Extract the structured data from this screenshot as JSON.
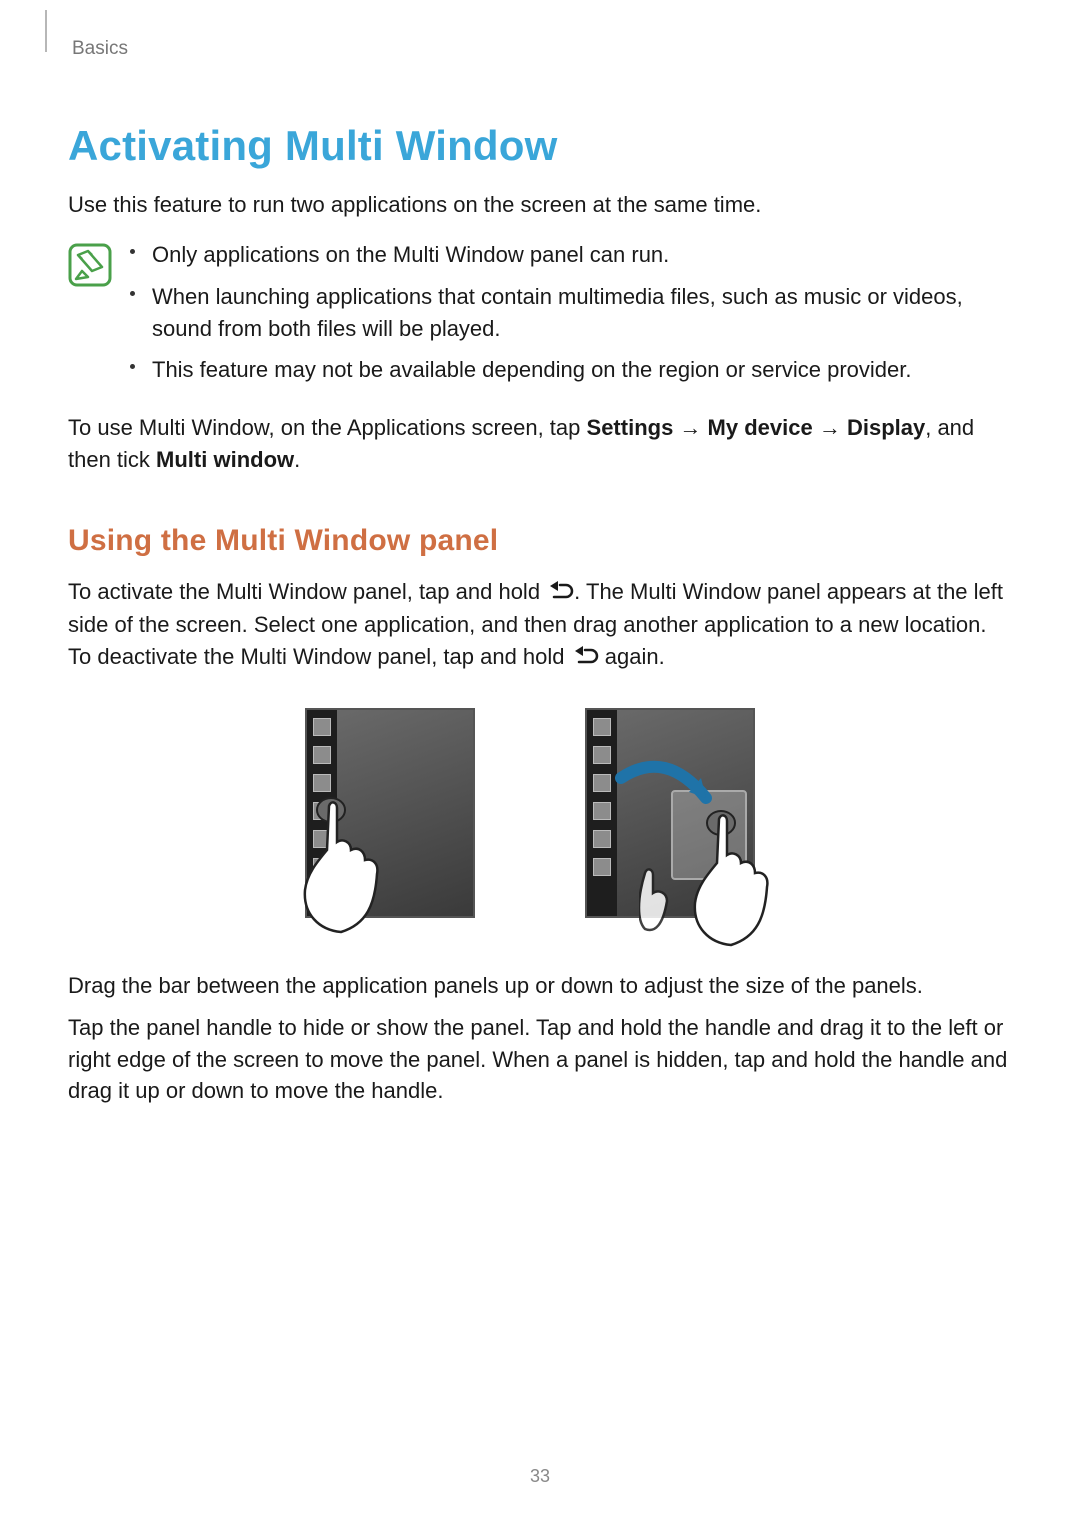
{
  "header": {
    "section": "Basics"
  },
  "title": "Activating Multi Window",
  "intro": "Use this feature to run two applications on the screen at the same time.",
  "notes": {
    "items": [
      "Only applications on the Multi Window panel can run.",
      "When launching applications that contain multimedia files, such as music or videos, sound from both files will be played.",
      "This feature may not be available depending on the region or service provider."
    ]
  },
  "enable_line": {
    "pre": "To use Multi Window, on the Applications screen, tap ",
    "settings": "Settings",
    "arrow": " → ",
    "mydevice": "My device",
    "display": "Display",
    "mid": ", and then tick ",
    "mw": "Multi window",
    "end": "."
  },
  "subhead": "Using the Multi Window panel",
  "activate": {
    "pre": "To activate the Multi Window panel, tap and hold ",
    "mid": ". The Multi Window panel appears at the left side of the screen. Select one application, and then drag another application to a new location. To deactivate the Multi Window panel, tap and hold ",
    "post": " again."
  },
  "drag_para": "Drag the bar between the application panels up or down to adjust the size of the panels.",
  "handle_para": "Tap the panel handle to hide or show the panel. Tap and hold the handle and drag it to the left or right edge of the screen to move the panel. When a panel is hidden, tap and hold the handle and drag it up or down to move the handle.",
  "page_number": "33"
}
